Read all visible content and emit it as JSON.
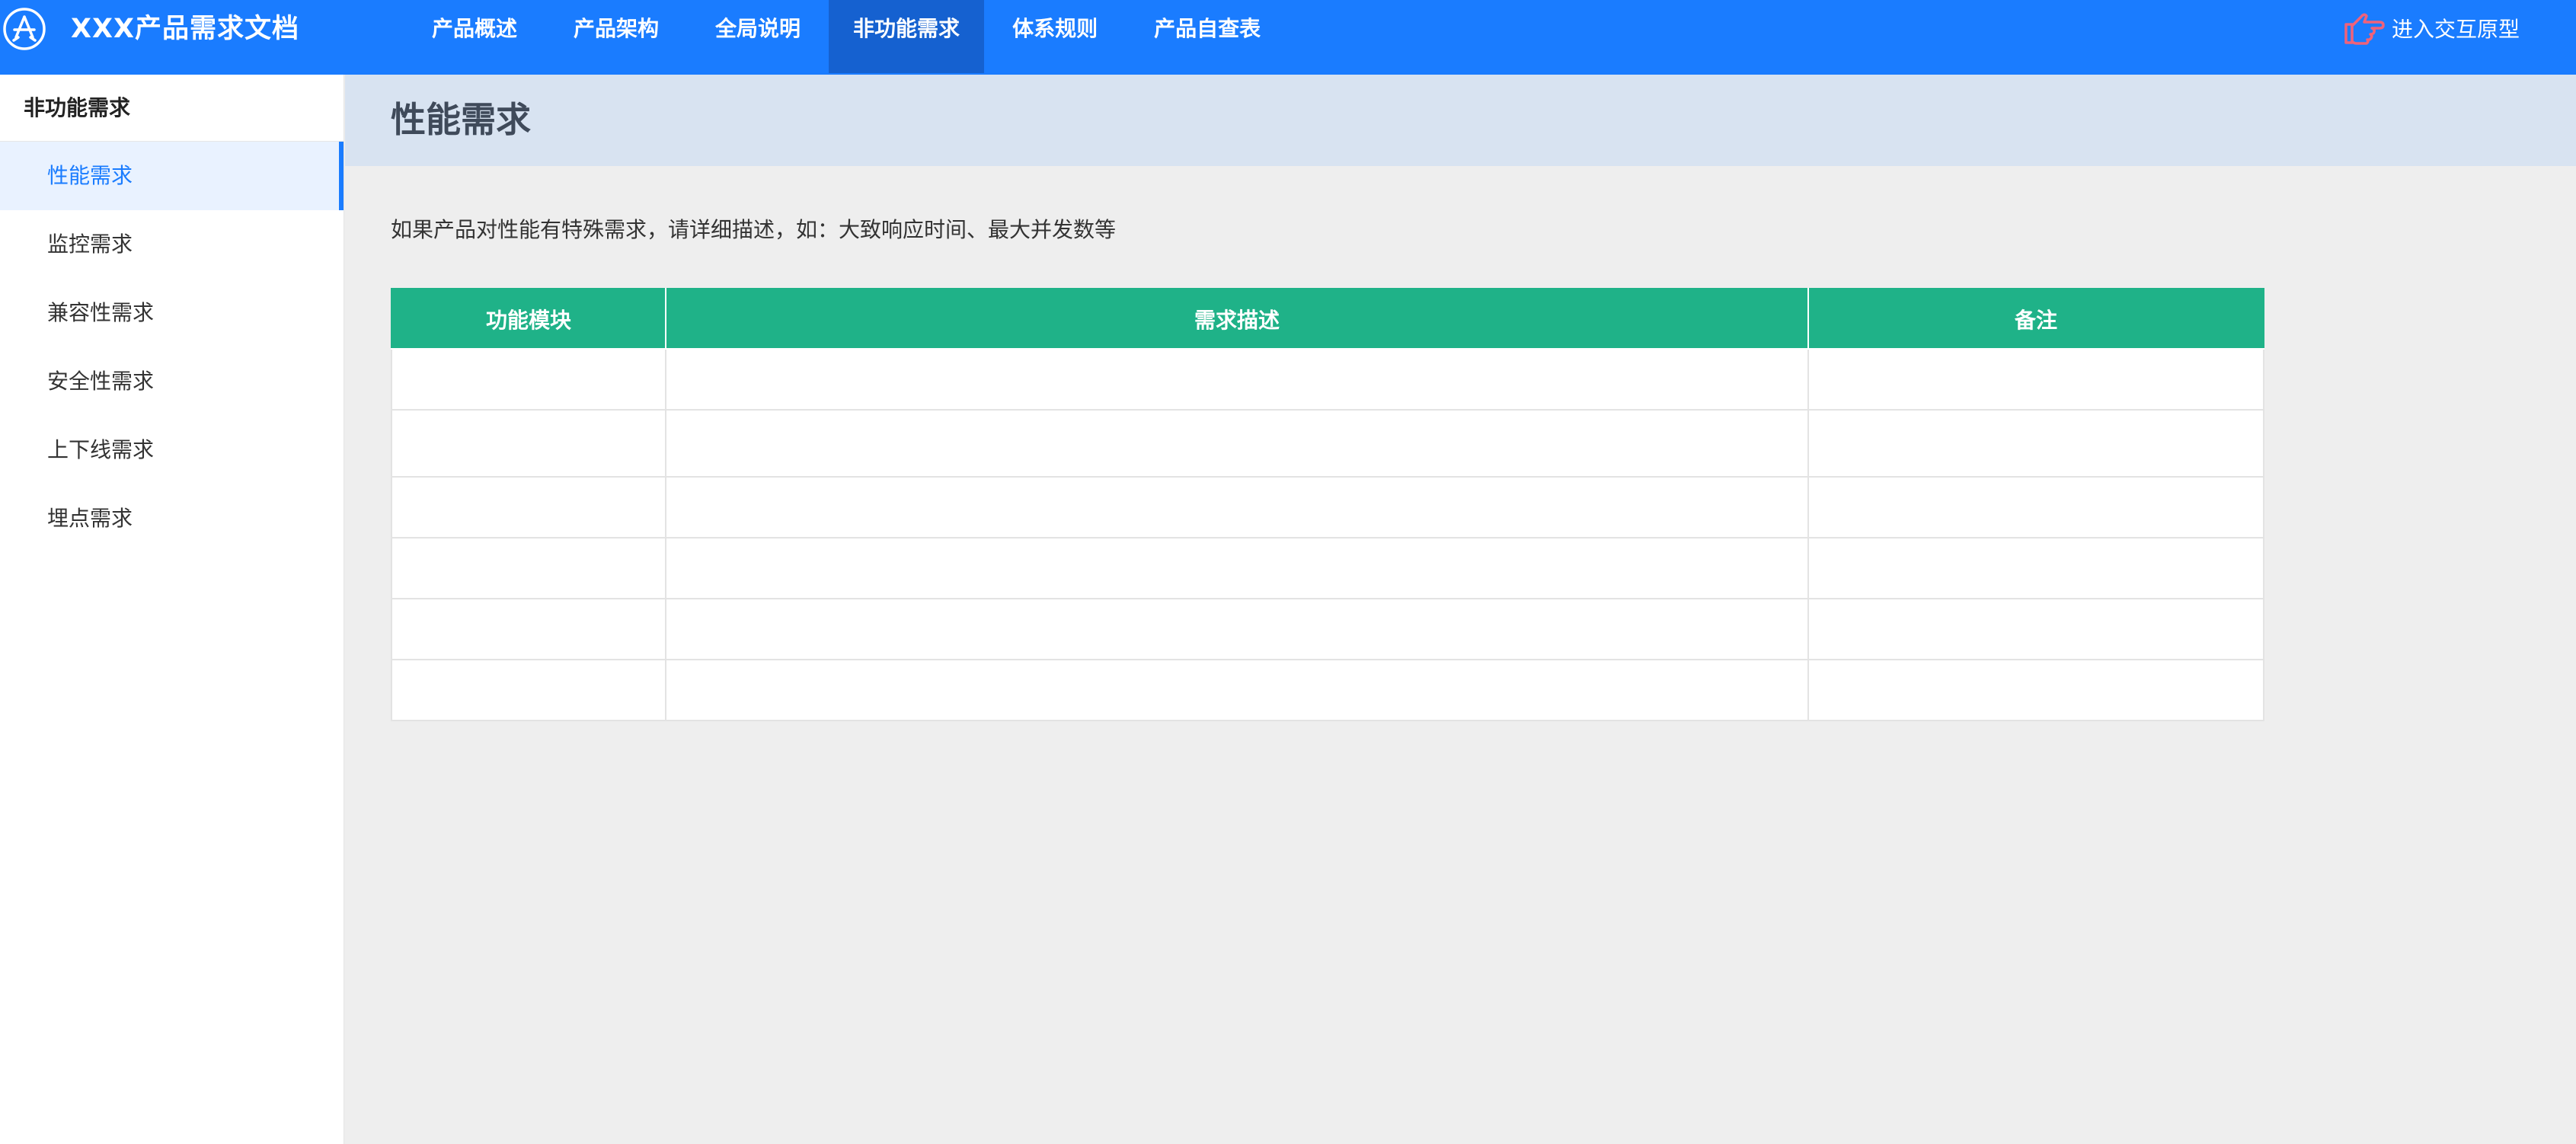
{
  "header": {
    "app_title": "XXX产品需求文档",
    "logo_icon": "app-store-icon",
    "nav": [
      {
        "label": "产品概述",
        "active": false
      },
      {
        "label": "产品架构",
        "active": false
      },
      {
        "label": "全局说明",
        "active": false
      },
      {
        "label": "非功能需求",
        "active": true
      },
      {
        "label": "体系规则",
        "active": false
      },
      {
        "label": "产品自查表",
        "active": false
      }
    ],
    "prototype_link": {
      "label": "进入交互原型",
      "icon": "pointing-hand-icon"
    }
  },
  "sidebar": {
    "heading": "非功能需求",
    "items": [
      {
        "label": "性能需求",
        "active": true
      },
      {
        "label": "监控需求",
        "active": false
      },
      {
        "label": "兼容性需求",
        "active": false
      },
      {
        "label": "安全性需求",
        "active": false
      },
      {
        "label": "上下线需求",
        "active": false
      },
      {
        "label": "埋点需求",
        "active": false
      }
    ]
  },
  "main": {
    "title": "性能需求",
    "description": "如果产品对性能有特殊需求，请详细描述，如：大致响应时间、最大并发数等",
    "table": {
      "columns": [
        "功能模块",
        "需求描述",
        "备注"
      ],
      "rows": [
        [
          "",
          "",
          ""
        ],
        [
          "",
          "",
          ""
        ],
        [
          "",
          "",
          ""
        ],
        [
          "",
          "",
          ""
        ],
        [
          "",
          "",
          ""
        ],
        [
          "",
          "",
          ""
        ]
      ]
    }
  },
  "colors": {
    "topbar": "#1a7cff",
    "nav_active": "#1561d0",
    "table_header": "#1fb288",
    "page_header_bg": "#d8e3f1",
    "accent": "#1a7cff",
    "hand_icon": "#f0627a"
  }
}
